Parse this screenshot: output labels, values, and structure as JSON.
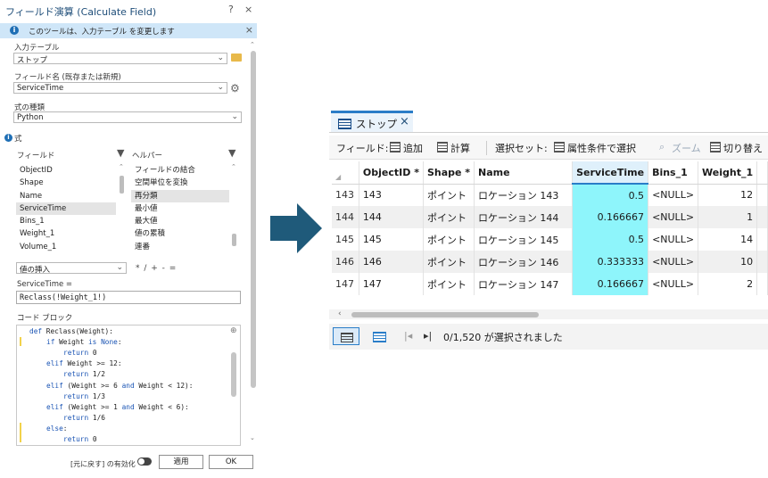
{
  "pane": {
    "title": "フィールド演算 (Calculate Field)",
    "help": "?",
    "close": "×",
    "info": "このツールは、入力テーブル を変更します",
    "input_table_label": "入力テーブル",
    "input_table_value": "ストップ",
    "field_name_label": "フィールド名 (既存または新規)",
    "field_name_value": "ServiceTime",
    "expr_type_label": "式の種類",
    "expr_type_value": "Python",
    "expression_heading": "式",
    "fields_label": "フィールド",
    "helpers_label": "ヘルパー",
    "fields": [
      "ObjectID",
      "Shape",
      "Name",
      "ServiceTime",
      "Bins_1",
      "Weight_1",
      "Volume_1"
    ],
    "fields_selected": "ServiceTime",
    "helpers": [
      "フィールドの結合",
      "空間単位を変換",
      "再分類",
      "最小値",
      "最大値",
      "値の累積",
      "連番"
    ],
    "helpers_selected": "再分類",
    "insert_values": "値の挿入",
    "operators": "*   /   +   -   =",
    "expr_label": "ServiceTime =",
    "expr_value": "Reclass(!Weight_1!)",
    "code_block_label": "コード ブロック",
    "code": [
      {
        "t": "def Reclass(Weight):",
        "ind": 0
      },
      {
        "t": "if Weight is None:",
        "ind": 1
      },
      {
        "t": "return 0",
        "ind": 2
      },
      {
        "t": "elif Weight >= 12:",
        "ind": 1
      },
      {
        "t": "return 1/2",
        "ind": 2
      },
      {
        "t": "elif (Weight >= 6 and Weight < 12):",
        "ind": 1
      },
      {
        "t": "return 1/3",
        "ind": 2
      },
      {
        "t": "elif (Weight >= 1 and Weight < 6):",
        "ind": 1
      },
      {
        "t": "return 1/6",
        "ind": 2
      },
      {
        "t": "else:",
        "ind": 1
      },
      {
        "t": "return 0",
        "ind": 2
      }
    ],
    "undo_toggle_label": "[元に戻す] の有効化",
    "apply_label": "適用",
    "ok_label": "OK"
  },
  "table": {
    "tab_label": "ストップ",
    "tab_close": "×",
    "toolbar": {
      "fields": "フィールド:",
      "add": "追加",
      "calculate": "計算",
      "selection": "選択セット:",
      "select_by_attr": "属性条件で選択",
      "zoom": "ズーム",
      "switch": "切り替え"
    },
    "columns": [
      "ObjectID *",
      "Shape *",
      "Name",
      "ServiceTime",
      "Bins_1",
      "Weight_1"
    ],
    "highlight_column": "ServiceTime",
    "rows": [
      {
        "rownum": "143",
        "oid": "143",
        "shape": "ポイント",
        "name": "ロケーション 143",
        "st": "0.5",
        "bins": "<NULL>",
        "weight": "12"
      },
      {
        "rownum": "144",
        "oid": "144",
        "shape": "ポイント",
        "name": "ロケーション 144",
        "st": "0.166667",
        "bins": "<NULL>",
        "weight": "1"
      },
      {
        "rownum": "145",
        "oid": "145",
        "shape": "ポイント",
        "name": "ロケーション 145",
        "st": "0.5",
        "bins": "<NULL>",
        "weight": "14"
      },
      {
        "rownum": "146",
        "oid": "146",
        "shape": "ポイント",
        "name": "ロケーション 146",
        "st": "0.333333",
        "bins": "<NULL>",
        "weight": "10"
      },
      {
        "rownum": "147",
        "oid": "147",
        "shape": "ポイント",
        "name": "ロケーション 147",
        "st": "0.166667",
        "bins": "<NULL>",
        "weight": "2"
      }
    ],
    "status": "0/1,520 が選択されました"
  },
  "colors": {
    "accent": "#2a7dc8",
    "highlight_cell": "#8ef5fb",
    "arrow": "#1f5a7a"
  }
}
